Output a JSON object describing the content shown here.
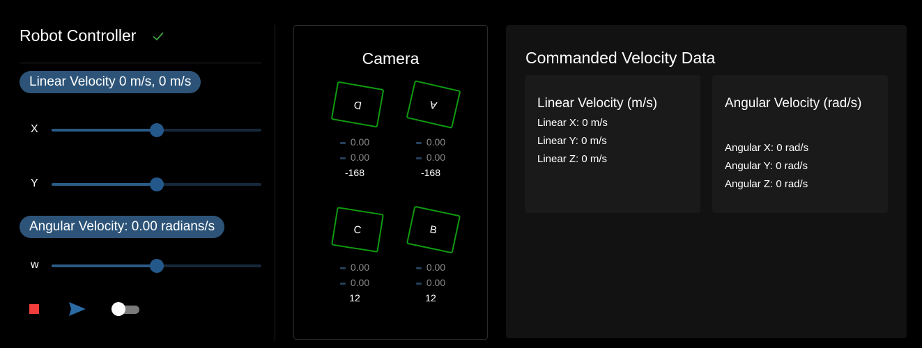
{
  "controller": {
    "title": "Robot Controller",
    "linear_pill": "Linear Velocity 0 m/s, 0 m/s",
    "angular_pill": "Angular Velocity: 0.00 radians/s",
    "sliders": {
      "x": {
        "label": "X",
        "value_fraction": 0.5
      },
      "y": {
        "label": "Y",
        "value_fraction": 0.5
      },
      "w": {
        "label": "w",
        "value_fraction": 0.5
      }
    },
    "toggle_on": false,
    "icons": [
      "check-icon",
      "stop-icon",
      "send-icon"
    ],
    "colors": {
      "accent": "#2d5478",
      "check": "#3fa33f",
      "stop": "#f23d3a",
      "send": "#2b6aa3"
    }
  },
  "camera": {
    "title": "Camera",
    "wheels": {
      "d": {
        "label": "D",
        "v1": "0.00",
        "v2": "0.00",
        "angle": "-168"
      },
      "a": {
        "label": "A",
        "v1": "0.00",
        "v2": "0.00",
        "angle": "-168"
      },
      "c": {
        "label": "C",
        "v1": "0.00",
        "v2": "0.00",
        "angle": "12"
      },
      "b": {
        "label": "B",
        "v1": "0.00",
        "v2": "0.00",
        "angle": "12"
      }
    },
    "wheel_color": "#0f9a0f"
  },
  "velocity_data": {
    "title": "Commanded Velocity Data",
    "linear": {
      "title": "Linear Velocity (m/s)",
      "lines": [
        "Linear X: 0 m/s",
        "Linear Y: 0 m/s",
        "Linear Z: 0 m/s"
      ]
    },
    "angular": {
      "title": "Angular Velocity (rad/s)",
      "lines": [
        "Angular X: 0 rad/s",
        "Angular Y: 0 rad/s",
        "Angular Z: 0 rad/s"
      ]
    }
  }
}
